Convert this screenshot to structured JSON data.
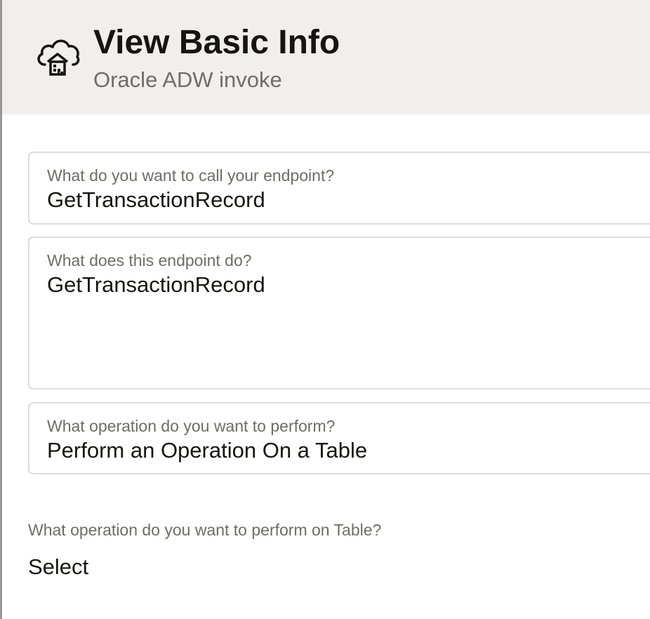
{
  "header": {
    "icon": "cloud-database-icon",
    "title": "View Basic Info",
    "subtitle": "Oracle ADW invoke"
  },
  "fields": {
    "endpoint_name": {
      "label": "What do you want to call your endpoint?",
      "value": "GetTransactionRecord"
    },
    "endpoint_description": {
      "label": "What does this endpoint do?",
      "value": "GetTransactionRecord"
    },
    "operation": {
      "label": "What operation do you want to perform?",
      "value": "Perform an Operation On a Table"
    },
    "table_operation": {
      "label": "What operation do you want to perform on Table?",
      "value": "Select"
    }
  },
  "colors": {
    "header_background": "#f1efed",
    "text_primary": "#161513",
    "text_secondary": "#6f6c69",
    "field_border": "#dedcda"
  }
}
